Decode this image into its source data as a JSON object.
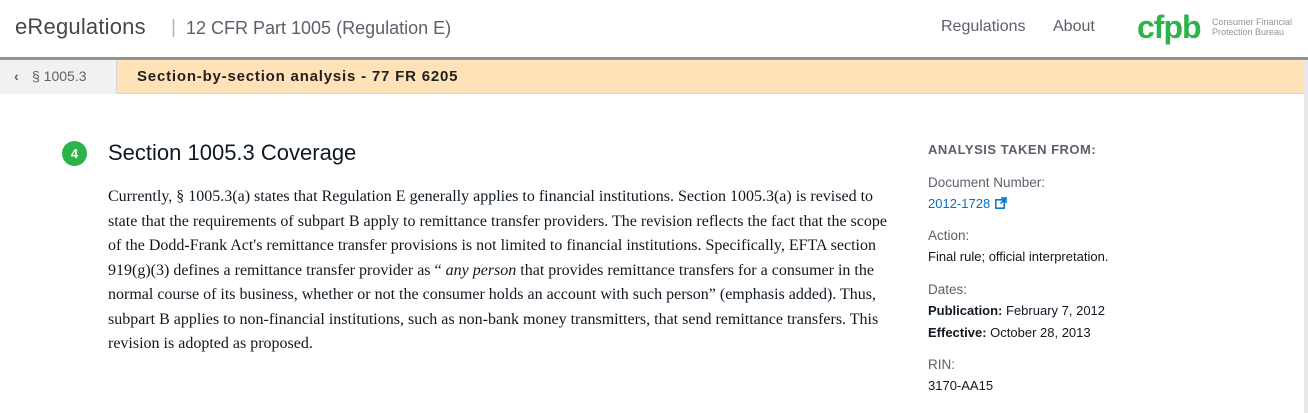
{
  "header": {
    "brand": "eRegulations",
    "separator": "|",
    "regulation": "12 CFR Part 1005 (Regulation E)",
    "nav": {
      "regulations": "Regulations",
      "about": "About"
    },
    "logo": {
      "text": "cfpb",
      "line1": "Consumer Financial",
      "line2": "Protection Bureau",
      "color": "#2cb34a"
    }
  },
  "subbar": {
    "back_label": "§ 1005.3",
    "title": "Section-by-section analysis - 77 FR 6205",
    "background": "#ffe2b8"
  },
  "main": {
    "badge": "4",
    "heading": "Section 1005.3 Coverage",
    "paragraph": {
      "part1": "Currently, § 1005.3(a) states that Regulation E generally applies to financial institutions. Section 1005.3(a) is revised to state that the requirements of subpart B apply to remittance transfer providers. The revision reflects the fact that the scope of the Dodd-Frank Act's remittance transfer provisions is not limited to financial institutions. Specifically, EFTA section 919(g)(3) defines a remittance transfer provider as “ ",
      "emphasis": "any person",
      "part2": " that provides remittance transfers for a consumer in the normal course of its business, whether or not the consumer holds an account with such person” (emphasis added). Thus, subpart B applies to non-financial institutions, such as non-bank money transmitters, that send remittance transfers. This revision is adopted as proposed."
    }
  },
  "sidebar": {
    "heading": "ANALYSIS TAKEN FROM:",
    "document_number_label": "Document Number:",
    "document_number": "2012-1728",
    "action_label": "Action:",
    "action": "Final rule; official interpretation.",
    "dates_label": "Dates:",
    "publication_label": "Publication:",
    "publication": "February 7, 2012",
    "effective_label": "Effective:",
    "effective": "October 28, 2013",
    "rin_label": "RIN:",
    "rin": "3170-AA15"
  }
}
